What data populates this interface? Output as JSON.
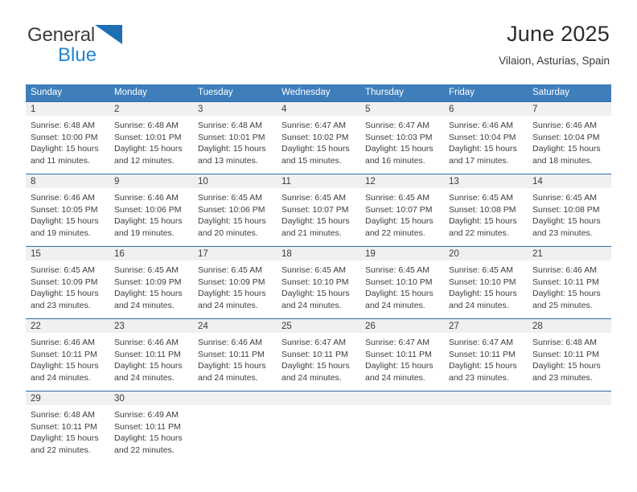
{
  "brand": {
    "name_part1": "General",
    "name_part2": "Blue",
    "logo_icon": "triangle-logo-icon"
  },
  "header": {
    "title": "June 2025",
    "subtitle": "Vilaion, Asturias, Spain"
  },
  "calendar": {
    "weekday_headers": [
      "Sunday",
      "Monday",
      "Tuesday",
      "Wednesday",
      "Thursday",
      "Friday",
      "Saturday"
    ],
    "colors": {
      "header_bg": "#3d7ebb",
      "header_text": "#ffffff",
      "daynum_bg": "#f0f0f0",
      "row_border": "#2f6ca6",
      "brand_blue": "#1f86d0",
      "logo_blue": "#1f6fb5"
    },
    "weeks": [
      [
        {
          "day": "1",
          "sunrise": "Sunrise: 6:48 AM",
          "sunset": "Sunset: 10:00 PM",
          "daylight_line1": "Daylight: 15 hours",
          "daylight_line2": "and 11 minutes."
        },
        {
          "day": "2",
          "sunrise": "Sunrise: 6:48 AM",
          "sunset": "Sunset: 10:01 PM",
          "daylight_line1": "Daylight: 15 hours",
          "daylight_line2": "and 12 minutes."
        },
        {
          "day": "3",
          "sunrise": "Sunrise: 6:48 AM",
          "sunset": "Sunset: 10:01 PM",
          "daylight_line1": "Daylight: 15 hours",
          "daylight_line2": "and 13 minutes."
        },
        {
          "day": "4",
          "sunrise": "Sunrise: 6:47 AM",
          "sunset": "Sunset: 10:02 PM",
          "daylight_line1": "Daylight: 15 hours",
          "daylight_line2": "and 15 minutes."
        },
        {
          "day": "5",
          "sunrise": "Sunrise: 6:47 AM",
          "sunset": "Sunset: 10:03 PM",
          "daylight_line1": "Daylight: 15 hours",
          "daylight_line2": "and 16 minutes."
        },
        {
          "day": "6",
          "sunrise": "Sunrise: 6:46 AM",
          "sunset": "Sunset: 10:04 PM",
          "daylight_line1": "Daylight: 15 hours",
          "daylight_line2": "and 17 minutes."
        },
        {
          "day": "7",
          "sunrise": "Sunrise: 6:46 AM",
          "sunset": "Sunset: 10:04 PM",
          "daylight_line1": "Daylight: 15 hours",
          "daylight_line2": "and 18 minutes."
        }
      ],
      [
        {
          "day": "8",
          "sunrise": "Sunrise: 6:46 AM",
          "sunset": "Sunset: 10:05 PM",
          "daylight_line1": "Daylight: 15 hours",
          "daylight_line2": "and 19 minutes."
        },
        {
          "day": "9",
          "sunrise": "Sunrise: 6:46 AM",
          "sunset": "Sunset: 10:06 PM",
          "daylight_line1": "Daylight: 15 hours",
          "daylight_line2": "and 19 minutes."
        },
        {
          "day": "10",
          "sunrise": "Sunrise: 6:45 AM",
          "sunset": "Sunset: 10:06 PM",
          "daylight_line1": "Daylight: 15 hours",
          "daylight_line2": "and 20 minutes."
        },
        {
          "day": "11",
          "sunrise": "Sunrise: 6:45 AM",
          "sunset": "Sunset: 10:07 PM",
          "daylight_line1": "Daylight: 15 hours",
          "daylight_line2": "and 21 minutes."
        },
        {
          "day": "12",
          "sunrise": "Sunrise: 6:45 AM",
          "sunset": "Sunset: 10:07 PM",
          "daylight_line1": "Daylight: 15 hours",
          "daylight_line2": "and 22 minutes."
        },
        {
          "day": "13",
          "sunrise": "Sunrise: 6:45 AM",
          "sunset": "Sunset: 10:08 PM",
          "daylight_line1": "Daylight: 15 hours",
          "daylight_line2": "and 22 minutes."
        },
        {
          "day": "14",
          "sunrise": "Sunrise: 6:45 AM",
          "sunset": "Sunset: 10:08 PM",
          "daylight_line1": "Daylight: 15 hours",
          "daylight_line2": "and 23 minutes."
        }
      ],
      [
        {
          "day": "15",
          "sunrise": "Sunrise: 6:45 AM",
          "sunset": "Sunset: 10:09 PM",
          "daylight_line1": "Daylight: 15 hours",
          "daylight_line2": "and 23 minutes."
        },
        {
          "day": "16",
          "sunrise": "Sunrise: 6:45 AM",
          "sunset": "Sunset: 10:09 PM",
          "daylight_line1": "Daylight: 15 hours",
          "daylight_line2": "and 24 minutes."
        },
        {
          "day": "17",
          "sunrise": "Sunrise: 6:45 AM",
          "sunset": "Sunset: 10:09 PM",
          "daylight_line1": "Daylight: 15 hours",
          "daylight_line2": "and 24 minutes."
        },
        {
          "day": "18",
          "sunrise": "Sunrise: 6:45 AM",
          "sunset": "Sunset: 10:10 PM",
          "daylight_line1": "Daylight: 15 hours",
          "daylight_line2": "and 24 minutes."
        },
        {
          "day": "19",
          "sunrise": "Sunrise: 6:45 AM",
          "sunset": "Sunset: 10:10 PM",
          "daylight_line1": "Daylight: 15 hours",
          "daylight_line2": "and 24 minutes."
        },
        {
          "day": "20",
          "sunrise": "Sunrise: 6:45 AM",
          "sunset": "Sunset: 10:10 PM",
          "daylight_line1": "Daylight: 15 hours",
          "daylight_line2": "and 24 minutes."
        },
        {
          "day": "21",
          "sunrise": "Sunrise: 6:46 AM",
          "sunset": "Sunset: 10:11 PM",
          "daylight_line1": "Daylight: 15 hours",
          "daylight_line2": "and 25 minutes."
        }
      ],
      [
        {
          "day": "22",
          "sunrise": "Sunrise: 6:46 AM",
          "sunset": "Sunset: 10:11 PM",
          "daylight_line1": "Daylight: 15 hours",
          "daylight_line2": "and 24 minutes."
        },
        {
          "day": "23",
          "sunrise": "Sunrise: 6:46 AM",
          "sunset": "Sunset: 10:11 PM",
          "daylight_line1": "Daylight: 15 hours",
          "daylight_line2": "and 24 minutes."
        },
        {
          "day": "24",
          "sunrise": "Sunrise: 6:46 AM",
          "sunset": "Sunset: 10:11 PM",
          "daylight_line1": "Daylight: 15 hours",
          "daylight_line2": "and 24 minutes."
        },
        {
          "day": "25",
          "sunrise": "Sunrise: 6:47 AM",
          "sunset": "Sunset: 10:11 PM",
          "daylight_line1": "Daylight: 15 hours",
          "daylight_line2": "and 24 minutes."
        },
        {
          "day": "26",
          "sunrise": "Sunrise: 6:47 AM",
          "sunset": "Sunset: 10:11 PM",
          "daylight_line1": "Daylight: 15 hours",
          "daylight_line2": "and 24 minutes."
        },
        {
          "day": "27",
          "sunrise": "Sunrise: 6:47 AM",
          "sunset": "Sunset: 10:11 PM",
          "daylight_line1": "Daylight: 15 hours",
          "daylight_line2": "and 23 minutes."
        },
        {
          "day": "28",
          "sunrise": "Sunrise: 6:48 AM",
          "sunset": "Sunset: 10:11 PM",
          "daylight_line1": "Daylight: 15 hours",
          "daylight_line2": "and 23 minutes."
        }
      ],
      [
        {
          "day": "29",
          "sunrise": "Sunrise: 6:48 AM",
          "sunset": "Sunset: 10:11 PM",
          "daylight_line1": "Daylight: 15 hours",
          "daylight_line2": "and 22 minutes."
        },
        {
          "day": "30",
          "sunrise": "Sunrise: 6:49 AM",
          "sunset": "Sunset: 10:11 PM",
          "daylight_line1": "Daylight: 15 hours",
          "daylight_line2": "and 22 minutes."
        },
        {
          "day": "",
          "sunrise": "",
          "sunset": "",
          "daylight_line1": "",
          "daylight_line2": ""
        },
        {
          "day": "",
          "sunrise": "",
          "sunset": "",
          "daylight_line1": "",
          "daylight_line2": ""
        },
        {
          "day": "",
          "sunrise": "",
          "sunset": "",
          "daylight_line1": "",
          "daylight_line2": ""
        },
        {
          "day": "",
          "sunrise": "",
          "sunset": "",
          "daylight_line1": "",
          "daylight_line2": ""
        },
        {
          "day": "",
          "sunrise": "",
          "sunset": "",
          "daylight_line1": "",
          "daylight_line2": ""
        }
      ]
    ]
  }
}
